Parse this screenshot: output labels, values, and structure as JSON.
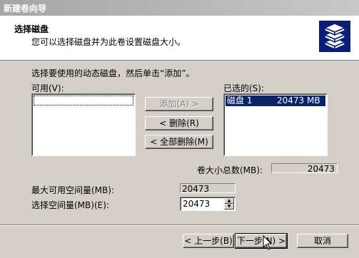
{
  "window": {
    "title": "新建卷向导"
  },
  "header": {
    "title": "选择磁盘",
    "subtitle": "您可以选择磁盘并为此卷设置磁盘大小。",
    "icon": "disk-stack-icon"
  },
  "instruction": "选择要使用的动态磁盘，然后单击“添加”。",
  "available": {
    "label": "可用(V):",
    "items": []
  },
  "selected": {
    "label": "已选的(S):",
    "items": [
      {
        "name": "磁盘 1",
        "size": "20473 MB"
      }
    ]
  },
  "buttons": {
    "add": "添加(A) >",
    "remove": "< 删除(R)",
    "remove_all": "< 全部删除(M)",
    "back": "< 上一步(B)",
    "next": "下一步(N) >",
    "cancel": "取消"
  },
  "total": {
    "label": "卷大小总数(MB):",
    "value": "20473"
  },
  "max_space": {
    "label": "最大可用空间量(MB):",
    "value": "20473"
  },
  "select_space": {
    "label": "选择空间量(MB)(E):",
    "value": "20473"
  }
}
